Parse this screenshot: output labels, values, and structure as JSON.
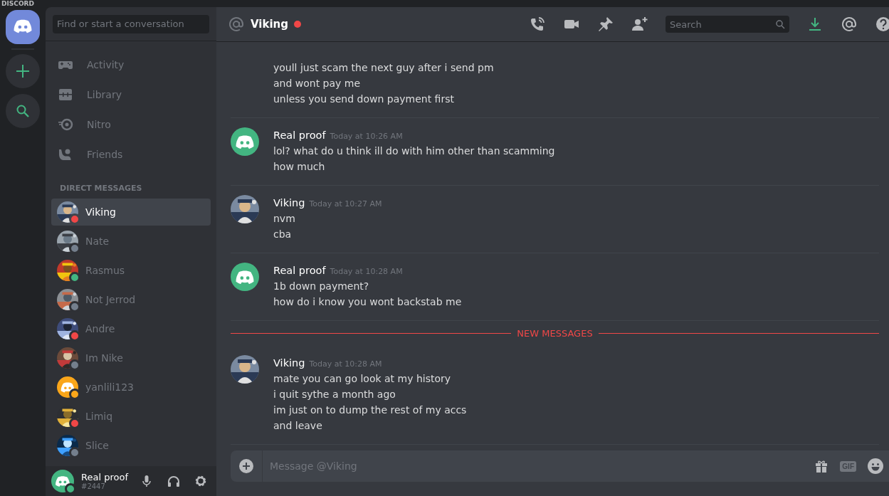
{
  "app_title": "DISCORD",
  "guilds": [
    {
      "kind": "home",
      "selected": true
    },
    {
      "kind": "add"
    },
    {
      "kind": "explore"
    }
  ],
  "sidebar": {
    "search": {
      "placeholder": "Find or start a conversation"
    },
    "nav": [
      {
        "kind": "activity",
        "label": "Activity"
      },
      {
        "kind": "library",
        "label": "Library"
      },
      {
        "kind": "nitro",
        "label": "Nitro"
      },
      {
        "kind": "friends",
        "label": "Friends"
      }
    ],
    "section_title": "DIRECT MESSAGES",
    "dms": [
      {
        "name": "Viking",
        "selected": true,
        "color": "#f04747",
        "kind": "picture"
      },
      {
        "name": "Nate",
        "selected": false,
        "color": "#747f8d",
        "kind": "picture"
      },
      {
        "name": "Rasmus",
        "selected": false,
        "color": "#43b581",
        "kind": "picture"
      },
      {
        "name": "Not Jerrod",
        "selected": false,
        "color": "#747f8d",
        "kind": "picture"
      },
      {
        "name": "Andre",
        "selected": false,
        "color": "#f04747",
        "kind": "picture"
      },
      {
        "name": "Im Nike",
        "selected": false,
        "color": "#747f8d",
        "kind": "picture"
      },
      {
        "name": "yanlili123",
        "selected": false,
        "color": "#faa61a",
        "kind": "logo"
      },
      {
        "name": "Limiq",
        "selected": false,
        "color": "#f04747",
        "kind": "picture"
      },
      {
        "name": "Slice",
        "selected": false,
        "color": "#747f8d",
        "kind": "picture"
      }
    ],
    "user": {
      "name": "Real proof",
      "tag": "#2447",
      "color": "#43b581"
    }
  },
  "header": {
    "title": "Viking",
    "color": "#f04747",
    "search": {
      "placeholder": "Search"
    }
  },
  "messages": [
    {
      "lines": [
        "youll just scam the next guy after i send pm",
        "and wont pay me",
        "unless you send down payment first"
      ]
    },
    {
      "kind": "logo",
      "author": "Real proof",
      "time": "Today at 10:26 AM",
      "lines": [
        "lol? what do u think ill do with him other than scamming",
        "how much"
      ]
    },
    {
      "kind": "picture",
      "author": "Viking",
      "time": "Today at 10:27 AM",
      "lines": [
        "nvm",
        "cba"
      ]
    },
    {
      "kind": "logo",
      "author": "Real proof",
      "time": "Today at 10:28 AM",
      "lines": [
        "1b down payment?",
        "how do i know you wont backstab me"
      ]
    },
    {
      "kind": "divider",
      "label": "NEW MESSAGES"
    },
    {
      "kind": "picture",
      "author": "Viking",
      "time": "Today at 10:28 AM",
      "lines": [
        "mate you can go look at my history",
        "i quit sythe a month ago",
        "im just on to dump the rest of my accs",
        "and leave"
      ]
    }
  ],
  "composer": {
    "placeholder": "Message @Viking",
    "gif_label": "GIF"
  }
}
